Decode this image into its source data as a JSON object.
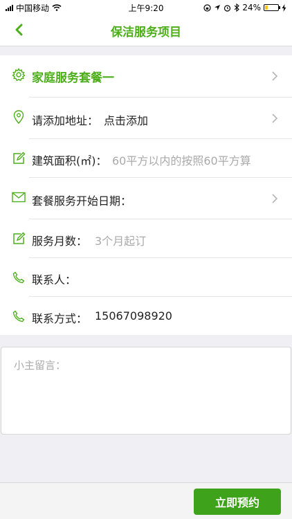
{
  "status_bar": {
    "carrier": "中国移动",
    "time": "上午9:20",
    "battery_percent": "24%",
    "battery_level": 0.24
  },
  "nav": {
    "title": "保洁服务项目"
  },
  "form": {
    "package": {
      "label": "家庭服务套餐一"
    },
    "address": {
      "label": "请添加地址：",
      "value": "点击添加"
    },
    "area": {
      "label": "建筑面积(㎡)：",
      "placeholder": "60平方以内的按照60平方算"
    },
    "start_date": {
      "label": "套餐服务开始日期："
    },
    "months": {
      "label": "服务月数：",
      "placeholder": "3个月起订"
    },
    "contact": {
      "label": "联系人：",
      "value": ""
    },
    "phone": {
      "label": "联系方式：",
      "value": "15067098920"
    }
  },
  "message": {
    "placeholder": "小主留言："
  },
  "bottom": {
    "book_label": "立即预约"
  },
  "colors": {
    "accent": "#4caf1a",
    "button": "#3ea21a"
  }
}
